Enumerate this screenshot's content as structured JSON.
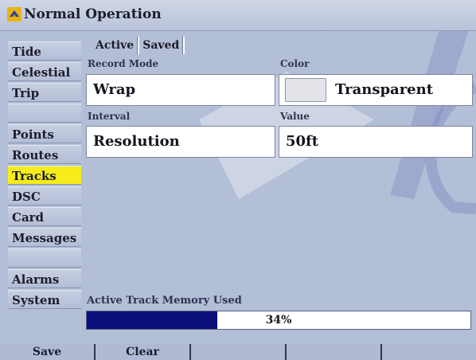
{
  "window": {
    "title": "Normal Operation"
  },
  "sidebar": {
    "items": [
      {
        "label": "Tide",
        "state": "normal"
      },
      {
        "label": "Celestial",
        "state": "normal"
      },
      {
        "label": "Trip",
        "state": "normal"
      },
      {
        "label": "",
        "state": "disabled"
      },
      {
        "label": "Points",
        "state": "normal"
      },
      {
        "label": "Routes",
        "state": "normal"
      },
      {
        "label": "Tracks",
        "state": "selected"
      },
      {
        "label": "DSC",
        "state": "normal"
      },
      {
        "label": "Card",
        "state": "normal"
      },
      {
        "label": "Messages",
        "state": "normal"
      },
      {
        "label": "",
        "state": "disabled"
      },
      {
        "label": "Alarms",
        "state": "normal"
      },
      {
        "label": "System",
        "state": "normal"
      }
    ]
  },
  "tabs": {
    "active_label": "Active",
    "saved_label": "Saved"
  },
  "settings": {
    "record_mode_label": "Record Mode",
    "record_mode_value": "Wrap",
    "color_label": "Color",
    "color_value": "Transparent",
    "interval_label": "Interval",
    "interval_value": "Resolution",
    "value_label": "Value",
    "value_value": "50ft"
  },
  "memory": {
    "label": "Active Track Memory Used",
    "percent_text": "34%",
    "fraction": 0.34
  },
  "softkeys": {
    "save_label": "Save",
    "clear_label": "Clear",
    "key3_label": "",
    "key4_label": "",
    "key5_label": ""
  },
  "colors": {
    "selected_highlight": "#f5ec19",
    "progress_fill": "#0a0f7a",
    "panel_background": "#b3bfd6",
    "color_swatch": "#e2e4e9"
  }
}
